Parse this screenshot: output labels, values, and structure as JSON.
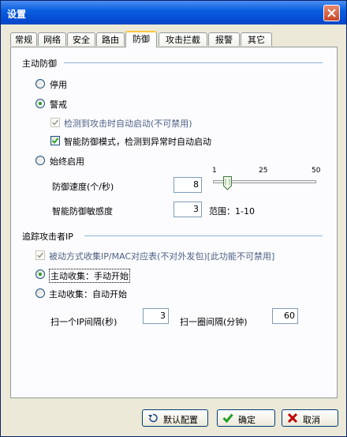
{
  "window": {
    "title": "设置"
  },
  "tabs": [
    {
      "label": "常规"
    },
    {
      "label": "网络"
    },
    {
      "label": "安全"
    },
    {
      "label": "路由"
    },
    {
      "label": "防御"
    },
    {
      "label": "攻击拦截"
    },
    {
      "label": "报警"
    },
    {
      "label": "其它"
    }
  ],
  "active_tab": "防御",
  "defense": {
    "group_title": "主动防御",
    "opt_off": "停用",
    "opt_alert": "警戒",
    "chk_auto_start": "检测到攻击时自动启动(不可禁用)",
    "chk_smart_mode": "智能防御模式，检测到异常时自动启动",
    "opt_always": "始终启用",
    "selected_mode": "警戒",
    "speed_label": "防御速度(个/秒)",
    "speed_value": "8",
    "slider_ticks": [
      "1",
      "25",
      "50"
    ],
    "slider_value_fraction": 0.14,
    "sensitivity_label": "智能防御敏感度",
    "sensitivity_value": "3",
    "range_label": "范围：1-10"
  },
  "tracking": {
    "group_title": "追踪攻击者IP",
    "chk_passive": "被动方式收集IP/MAC对应表(不对外发包)[此功能不可禁用]",
    "opt_manual": "主动收集：手动开始",
    "opt_auto": "主动收集：自动开始",
    "selected": "主动收集：手动开始",
    "ip_interval_label": "扫一个IP间隔(秒)",
    "ip_interval_value": "3",
    "cycle_interval_label": "扫一圈间隔(分钟)",
    "cycle_interval_value": "60"
  },
  "buttons": {
    "default": "默认配置",
    "ok": "确定",
    "cancel": "取消"
  },
  "colors": {
    "title_bar": "#0a5fe0",
    "active_tab_accent": "#ffc83c",
    "radio_dot": "#21a121",
    "ok_icon": "#21a121",
    "cancel_icon": "#c00000"
  }
}
